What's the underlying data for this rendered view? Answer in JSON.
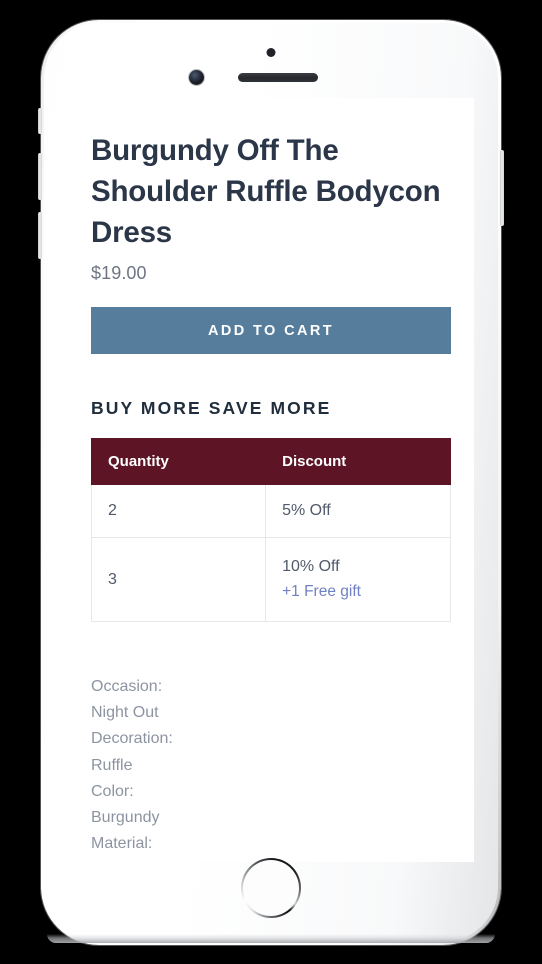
{
  "device": {
    "type": "smartphone-mockup",
    "hardware": {
      "earpiece": "earpiece-speaker",
      "front_camera": "front-camera",
      "sensor": "proximity-sensor",
      "home_button": "home-button",
      "silent_switch": "silent-switch",
      "volume_up": "volume-up-button",
      "volume_down": "volume-down-button",
      "power": "power-button"
    }
  },
  "product": {
    "title": "Burgundy Off The Shoulder Ruffle Bodycon Dress",
    "price": "$19.00"
  },
  "actions": {
    "add_to_cart_label": "ADD TO CART"
  },
  "promo": {
    "heading": "BUY MORE SAVE MORE",
    "table": {
      "headers": [
        "Quantity",
        "Discount"
      ],
      "rows": [
        {
          "quantity": "2",
          "discount": "5% Off",
          "gift": ""
        },
        {
          "quantity": "3",
          "discount": "10% Off",
          "gift": "+1 Free gift"
        }
      ]
    }
  },
  "specs": {
    "lines": [
      "Occasion:",
      "Night Out",
      "Decoration:",
      "Ruffle",
      "Color:",
      "Burgundy",
      "Material:"
    ]
  },
  "colors": {
    "accent_button": "#567d9b",
    "table_header": "#5d1526",
    "link": "#7180c2",
    "title_text": "#2b3648",
    "muted_text": "#8d94a1",
    "page_background": "#000000"
  }
}
